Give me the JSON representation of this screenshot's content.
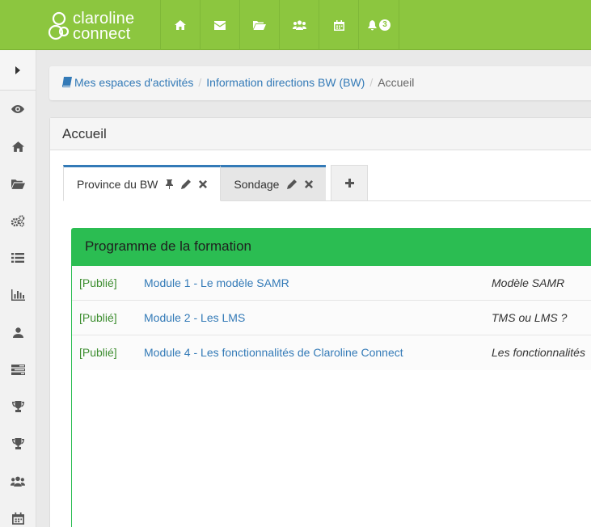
{
  "app": {
    "logo_line1": "claroline",
    "logo_line2": "connect",
    "notifications_count": "3",
    "brand_color": "#8cc63f",
    "widget_color": "#2bbd52",
    "link_color": "#337ab7"
  },
  "topnav": {
    "items": [
      {
        "icon": "home-icon"
      },
      {
        "icon": "envelope-icon"
      },
      {
        "icon": "folder-open-icon"
      },
      {
        "icon": "users-icon"
      },
      {
        "icon": "calendar-icon"
      },
      {
        "icon": "bell-icon"
      }
    ]
  },
  "sidebar": {
    "items": [
      {
        "icon": "eye-icon"
      },
      {
        "icon": "home-icon"
      },
      {
        "icon": "folder-open-icon"
      },
      {
        "icon": "cogs-icon"
      },
      {
        "icon": "list-icon"
      },
      {
        "icon": "bar-chart-icon"
      },
      {
        "icon": "user-icon"
      },
      {
        "icon": "tasks-icon"
      },
      {
        "icon": "trophy-icon"
      },
      {
        "icon": "trophy-icon"
      },
      {
        "icon": "users-icon"
      },
      {
        "icon": "calendar-icon"
      }
    ]
  },
  "breadcrumb": {
    "items": [
      "Mes espaces d'activités",
      "Information directions BW (BW)",
      "Accueil"
    ]
  },
  "panel": {
    "title": "Accueil"
  },
  "tabs": [
    {
      "label": "Province du BW"
    },
    {
      "label": "Sondage"
    }
  ],
  "widget": {
    "title": "Programme de la formation",
    "rows": [
      {
        "status": "[Publié]",
        "title": "Module 1 - Le modèle SAMR",
        "desc": "Modèle SAMR"
      },
      {
        "status": "[Publié]",
        "title": "Module 2 - Les LMS",
        "desc": "TMS ou LMS ?"
      },
      {
        "status": "[Publié]",
        "title": "Module 4 - Les fonctionnalités de Claroline Connect",
        "desc": "Les fonctionnalités"
      }
    ]
  }
}
